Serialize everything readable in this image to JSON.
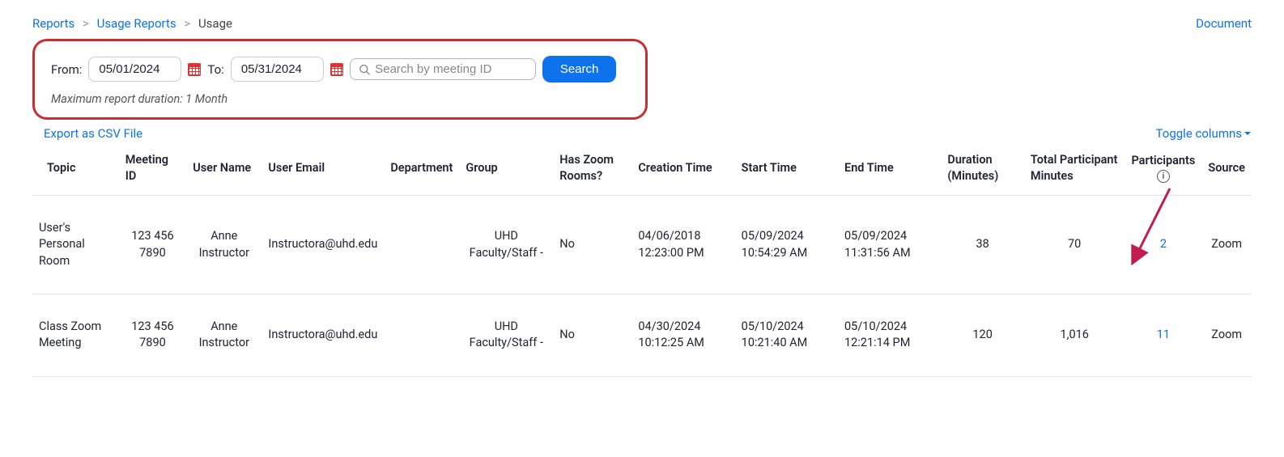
{
  "breadcrumb": {
    "root": "Reports",
    "sub": "Usage Reports",
    "current": "Usage",
    "sep": ">"
  },
  "doc_link": "Document",
  "filters": {
    "from_label": "From:",
    "from_value": "05/01/2024",
    "to_label": "To:",
    "to_value": "05/31/2024",
    "search_placeholder": "Search by meeting ID",
    "search_button": "Search",
    "max_note": "Maximum report duration: 1 Month"
  },
  "actions": {
    "export": "Export as CSV File",
    "toggle": "Toggle columns"
  },
  "columns": {
    "topic": "Topic",
    "meeting_id": "Meeting ID",
    "user_name": "User Name",
    "user_email": "User Email",
    "department": "Department",
    "group": "Group",
    "has_zoom_rooms": "Has Zoom Rooms?",
    "creation_time": "Creation Time",
    "start_time": "Start Time",
    "end_time": "End Time",
    "duration": "Duration (Minutes)",
    "total_participant_minutes": "Total Participant Minutes",
    "participants": "Participants",
    "source": "Source"
  },
  "rows": [
    {
      "topic": "User's Personal Room",
      "meeting_id": "123 456 7890",
      "user_name": "Anne Instructor",
      "user_email": "Instructora@uhd.edu",
      "department": "",
      "group": "UHD Faculty/Staff -",
      "has_zoom_rooms": "No",
      "creation_time": "04/06/2018 12:23:00 PM",
      "start_time": "05/09/2024 10:54:29 AM",
      "end_time": "05/09/2024 11:31:56 AM",
      "duration": "38",
      "total_participant_minutes": "70",
      "participants": "2",
      "source": "Zoom"
    },
    {
      "topic": "Class Zoom Meeting",
      "meeting_id": "123 456 7890",
      "user_name": "Anne Instructor",
      "user_email": "Instructora@uhd.edu",
      "department": "",
      "group": "UHD Faculty/Staff -",
      "has_zoom_rooms": "No",
      "creation_time": "04/30/2024 10:12:25 AM",
      "start_time": "05/10/2024 10:21:40 AM",
      "end_time": "05/10/2024 12:21:14 PM",
      "duration": "120",
      "total_participant_minutes": "1,016",
      "participants": "11",
      "source": "Zoom"
    }
  ]
}
